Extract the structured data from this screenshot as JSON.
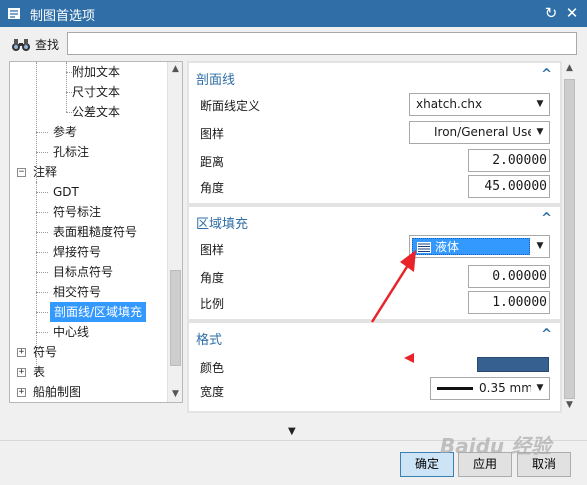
{
  "window": {
    "title": "制图首选项"
  },
  "search": {
    "label": "查找",
    "value": ""
  },
  "tree": {
    "items": [
      {
        "label": "附加文本"
      },
      {
        "label": "尺寸文本"
      },
      {
        "label": "公差文本"
      },
      {
        "label": "参考"
      },
      {
        "label": "孔标注"
      },
      {
        "label": "注释",
        "expander": "−"
      },
      {
        "label": "GDT"
      },
      {
        "label": "符号标注"
      },
      {
        "label": "表面粗糙度符号"
      },
      {
        "label": "焊接符号"
      },
      {
        "label": "目标点符号"
      },
      {
        "label": "相交符号"
      },
      {
        "label": "剖面线/区域填充",
        "selected": true
      },
      {
        "label": "中心线"
      },
      {
        "label": "符号",
        "expander": "+"
      },
      {
        "label": "表",
        "expander": "+"
      },
      {
        "label": "船舶制图",
        "expander": "+"
      }
    ]
  },
  "sections": {
    "crosshatch": {
      "title": "剖面线",
      "definition_label": "断面线定义",
      "definition_value": "xhatch.chx",
      "pattern_label": "图样",
      "pattern_value": "Iron/General Use",
      "distance_label": "距离",
      "distance_value": "2.00000",
      "angle_label": "角度",
      "angle_value": "45.00000"
    },
    "area_fill": {
      "title": "区域填充",
      "pattern_label": "图样",
      "pattern_value": "液体",
      "angle_label": "角度",
      "angle_value": "0.00000",
      "scale_label": "比例",
      "scale_value": "1.00000"
    },
    "format": {
      "title": "格式",
      "color_label": "颜色",
      "color_value": "#35608f",
      "width_label": "宽度",
      "width_value": "0.35 mm"
    }
  },
  "buttons": {
    "ok": "确定",
    "apply": "应用",
    "cancel": "取消"
  },
  "watermark": "Baidu 经验",
  "colors": {
    "accent": "#2f6ea6",
    "selection": "#3399ff",
    "annotation_red": "#e8232a"
  }
}
